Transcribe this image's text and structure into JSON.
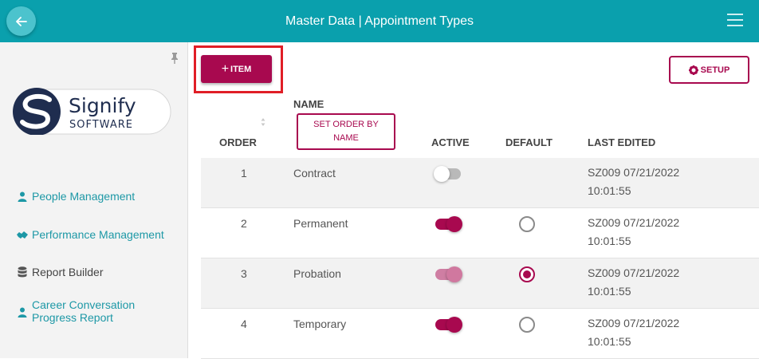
{
  "header": {
    "title": "Master Data | Appointment Types"
  },
  "sidebar": {
    "logo": {
      "brand": "Signify",
      "sub": "SOFTWARE"
    },
    "items": [
      {
        "label": "People Management",
        "icon": "user-icon"
      },
      {
        "label": "Performance Management",
        "icon": "handshake-icon"
      },
      {
        "label": "Report Builder",
        "icon": "database-icon"
      },
      {
        "label": "Career Conversation Progress Report",
        "icon": "user-icon"
      }
    ]
  },
  "toolbar": {
    "add_label": "ITEM",
    "setup_label": "SETUP"
  },
  "table": {
    "headers": {
      "order": "ORDER",
      "name": "NAME",
      "set_order_by_name": "SET ORDER BY NAME",
      "active": "ACTIVE",
      "default": "DEFAULT",
      "last_edited": "LAST EDITED"
    },
    "rows": [
      {
        "order": "1",
        "name": "Contract",
        "active": "off",
        "default": "none",
        "edited_line1": "SZ009 07/21/2022",
        "edited_line2": "10:01:55"
      },
      {
        "order": "2",
        "name": "Permanent",
        "active": "on",
        "default": "unchecked",
        "edited_line1": "SZ009 07/21/2022",
        "edited_line2": "10:01:55"
      },
      {
        "order": "3",
        "name": "Probation",
        "active": "on-disabled",
        "default": "checked",
        "edited_line1": "SZ009 07/21/2022",
        "edited_line2": "10:01:55"
      },
      {
        "order": "4",
        "name": "Temporary",
        "active": "on",
        "default": "unchecked",
        "edited_line1": "SZ009 07/21/2022",
        "edited_line2": "10:01:55"
      }
    ]
  },
  "colors": {
    "header": "#0aa0ad",
    "accent": "#a8094f",
    "link": "#1d98a6",
    "highlight": "#e01e26"
  }
}
